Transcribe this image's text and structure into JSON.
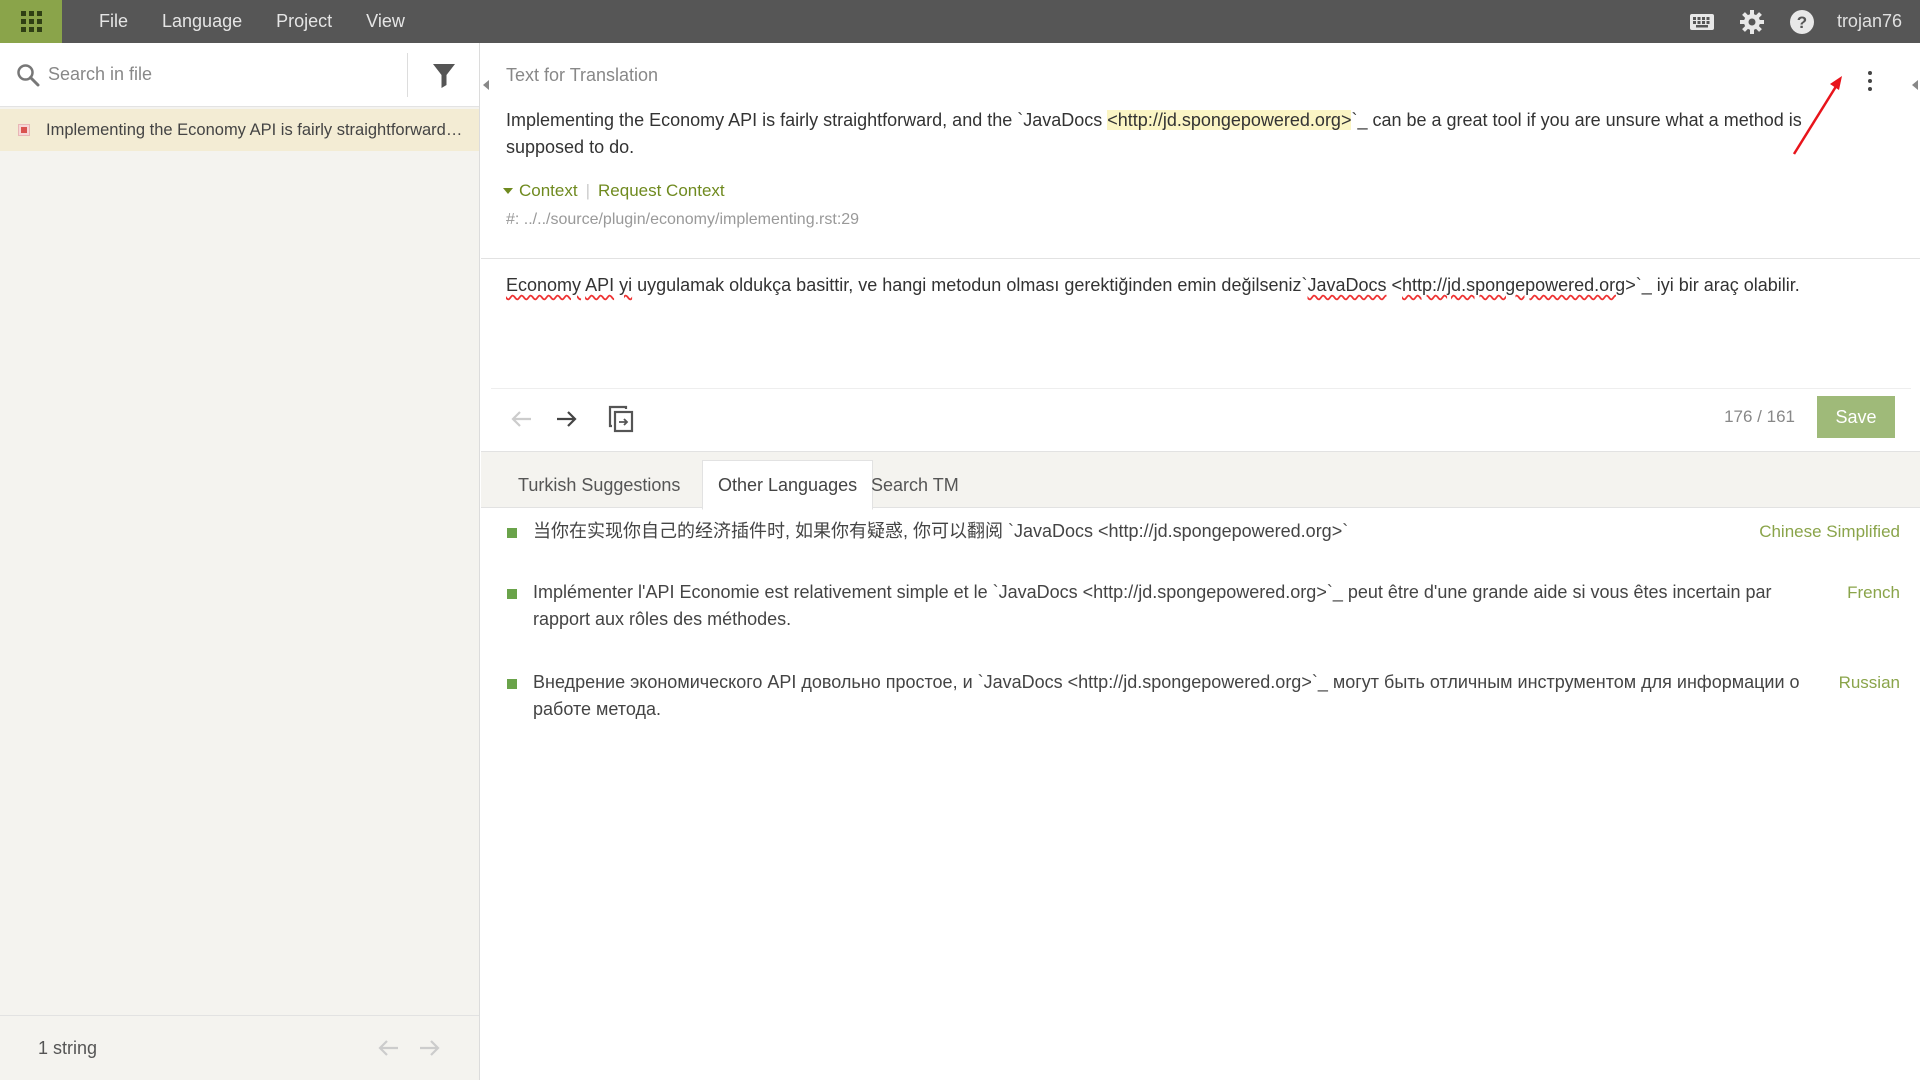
{
  "topbar": {
    "menu": [
      "File",
      "Language",
      "Project",
      "View"
    ],
    "icons": [
      "keyboard-icon",
      "gear-icon",
      "help-icon"
    ],
    "username": "trojan76"
  },
  "sidebar": {
    "search_placeholder": "Search in file",
    "items": [
      {
        "text": "Implementing the Economy API is fairly straightforward, and the `JavaDocs <http://jd.spongepowered.org>`_ can be a great tool",
        "status_color": "#d9534f"
      }
    ],
    "count_label": "1 string"
  },
  "main": {
    "section_title": "Text for Translation",
    "source": {
      "before": "Implementing the Economy API is fairly straightforward, and the `JavaDocs ",
      "highlight": "<http://jd.spongepowered.org>",
      "after": "`_ can be a great tool if you are unsure what a method is supposed to do."
    },
    "context_label": "Context",
    "request_context_label": "Request Context",
    "ref_path": "#: ../../source/plugin/economy/implementing.rst:29",
    "translation": {
      "w1": "Economy",
      "w2": "API",
      "w3": "yi",
      "t1": " uygulamak oldukça basittir, ve hangi metodun olması gerektiğinden emin değilseniz`",
      "w4": "JavaDocs",
      "t2": " <",
      "w5": "http://",
      "w6": "jd.spongepowered.org",
      "t3": ">`_  iyi bir araç olabilir."
    },
    "char_count": "176 / 161",
    "save_label": "Save",
    "tabs": [
      "Turkish Suggestions",
      "Other Languages",
      "Search TM"
    ],
    "active_tab": 1,
    "suggestions": [
      {
        "text": "当你在实现你自己的经济插件时, 如果你有疑惑, 你可以翻阅 `JavaDocs <http://jd.spongepowered.org>`",
        "lang": "Chinese Simplified"
      },
      {
        "text": "Implémenter l'API Economie est relativement simple et le `JavaDocs <http://jd.spongepowered.org>`_ peut être d'une grande aide si vous êtes incertain par rapport aux rôles des méthodes.",
        "lang": "French"
      },
      {
        "text": "Внедрение экономического API довольно простое, и `JavaDocs <http://jd.spongepowered.org>`_ могут быть отличным инструментом для информации о работе метода.",
        "lang": "Russian"
      }
    ]
  },
  "colors": {
    "accent": "#8aa44a",
    "save": "#9fba79",
    "topbar": "#565656",
    "annotation": "#e8141b"
  }
}
